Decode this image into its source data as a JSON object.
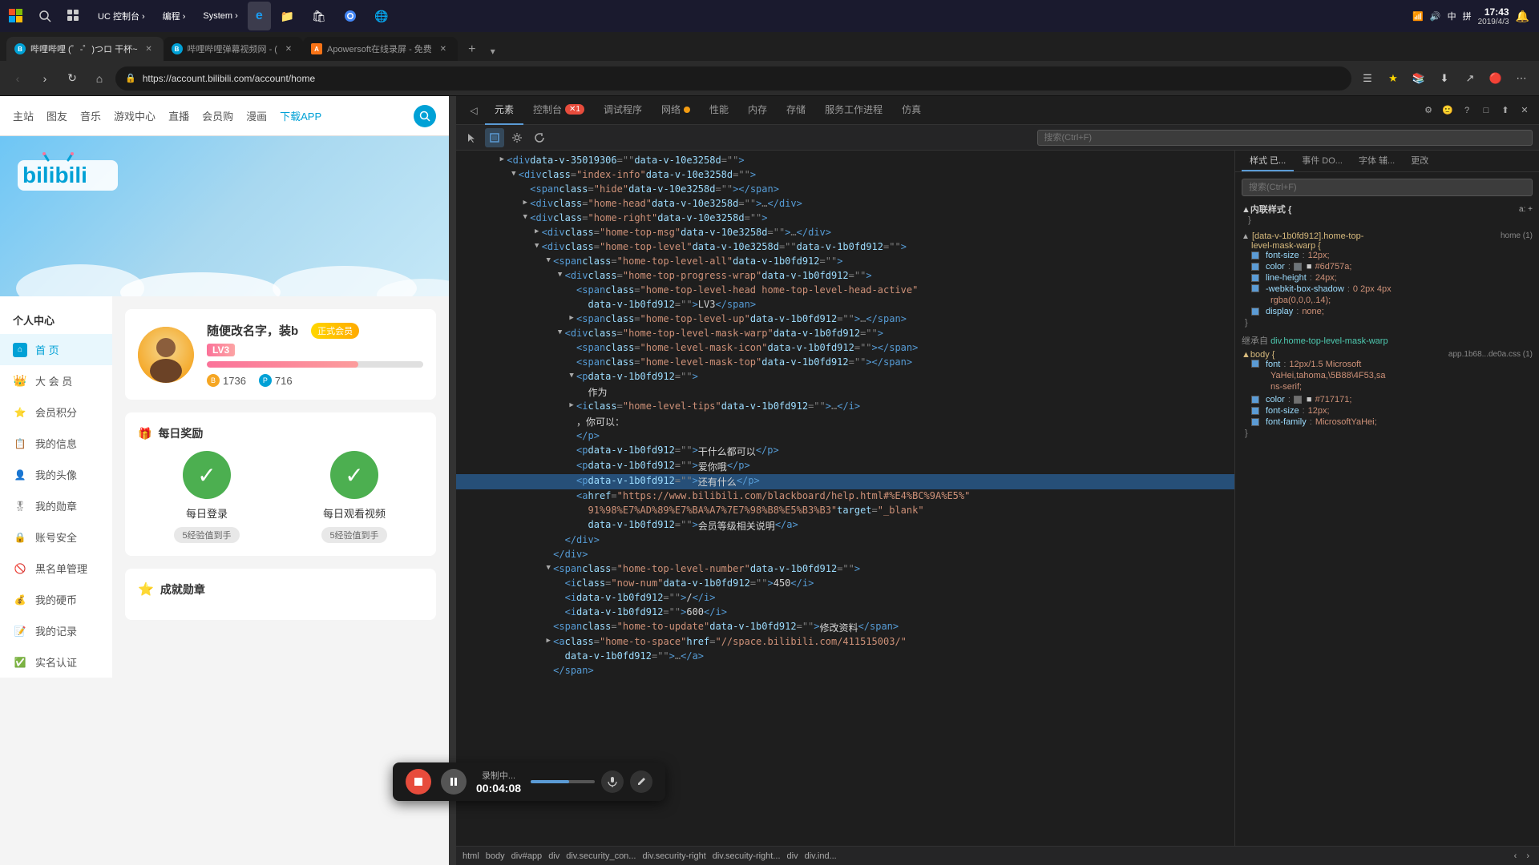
{
  "taskbar": {
    "start_icon": "⊞",
    "search_icon": "⚲",
    "apps": [
      {
        "label": "UC 控制台",
        "active": false,
        "has_arrow": true
      },
      {
        "label": "编程",
        "active": false,
        "has_arrow": true
      },
      {
        "label": "System",
        "active": false,
        "has_arrow": true
      }
    ],
    "ie_label": "e",
    "file_explorer_label": "📁",
    "store_label": "🛍",
    "chrome_label": "●",
    "edge_label": "🌐",
    "time": "17:43",
    "date": "2019/4/3"
  },
  "browser": {
    "tabs": [
      {
        "favicon_color": "#00a1d6",
        "title": "哔哩哔哩 (゜-゜)つロ 干杯~",
        "active": true
      },
      {
        "favicon_color": "#00a1d6",
        "title": "哔哩哔哩弹幕视频网 - (",
        "active": false
      },
      {
        "favicon_color": "#f97316",
        "title": "Apowersoft在线录屏 - 免费",
        "active": false
      }
    ],
    "url": "https://account.bilibili.com/account/home",
    "search_placeholder": "搜索(Ctrl+F)"
  },
  "bilibili": {
    "nav_items": [
      "主站",
      "图友",
      "音乐",
      "游戏中心",
      "直播",
      "会员购",
      "漫画"
    ],
    "download_app": "下载APP",
    "user_section": {
      "center_label": "个人中心",
      "username": "随便改名字，装b",
      "member_badge": "正式会员",
      "level": "LV3",
      "level_fill_percent": 70,
      "coins": "1736",
      "points": "716"
    },
    "sidebar_items": [
      {
        "label": "首 页",
        "icon": "🏠",
        "active": true
      },
      {
        "label": "大 会 员",
        "icon": "👑"
      },
      {
        "label": "会员积分",
        "icon": "⭐"
      },
      {
        "label": "我的信息",
        "icon": "📋"
      },
      {
        "label": "我的头像",
        "icon": "👤"
      },
      {
        "label": "我的勋章",
        "icon": "🎖"
      },
      {
        "label": "账号安全",
        "icon": "🔒"
      },
      {
        "label": "黑名单管理",
        "icon": "🚫"
      },
      {
        "label": "我的硬币",
        "icon": "💰"
      },
      {
        "label": "我的记录",
        "icon": "📝"
      },
      {
        "label": "实名认证",
        "icon": "✅"
      }
    ],
    "daily_rewards": {
      "title": "每日奖励",
      "items": [
        {
          "label": "每日登录",
          "reward": "5经验值到手"
        },
        {
          "label": "每日观看视频",
          "reward": "5经验值到手"
        }
      ]
    },
    "achievement": {
      "title": "成就勋章"
    }
  },
  "devtools": {
    "tabs": [
      "元素",
      "控制台",
      "调试程序",
      "网络",
      "性能",
      "内存",
      "存储",
      "服务工作进程",
      "仿真"
    ],
    "console_badge": "1",
    "network_dot": true,
    "search_placeholder": "搜索(Ctrl+F)",
    "toolbar_icons": [
      "cursor",
      "box",
      "gear",
      "refresh"
    ],
    "code_lines": [
      {
        "indent": 6,
        "toggle": "▶",
        "content": "<div data-v-35019306=\"\" data-v-10e3258d=\"\">"
      },
      {
        "indent": 8,
        "toggle": "▼",
        "content": "<div class=\"index-info\" data-v-10e3258d=\"\">"
      },
      {
        "indent": 10,
        "toggle": null,
        "content": "<span class=\"hide\" data-v-10e3258d=\"\"></span>"
      },
      {
        "indent": 10,
        "toggle": "▶",
        "content": "<div class=\"home-head\" data-v-10e3258d=\"\">…</div>"
      },
      {
        "indent": 10,
        "toggle": "▼",
        "content": "<div class=\"home-right\" data-v-10e3258d=\"\">"
      },
      {
        "indent": 12,
        "toggle": "▶",
        "content": "<div class=\"home-top-msg\" data-v-10e3258d=\"\">…</div>"
      },
      {
        "indent": 12,
        "toggle": "▼",
        "content": "<div class=\"home-top-level\" data-v-10e3258d=\"\" data-v-1b0fd912=\"\">"
      },
      {
        "indent": 14,
        "toggle": "▼",
        "content": "<span class=\"home-top-level-all\" data-v-1b0fd912=\"\">"
      },
      {
        "indent": 16,
        "toggle": "▼",
        "content": "<div class=\"home-top-progress-wrap\" data-v-1b0fd912=\"\">"
      },
      {
        "indent": 18,
        "toggle": null,
        "content": "<span class=\"home-top-level-head home-top-level-head-active\""
      },
      {
        "indent": 20,
        "toggle": null,
        "content": "data-v-1b0fd912=\"\">LV3</span>"
      },
      {
        "indent": 18,
        "toggle": "▶",
        "content": "<span class=\"home-top-level-up\" data-v-1b0fd912=\"\">…</span>"
      },
      {
        "indent": 16,
        "toggle": "▼",
        "content": "<div class=\"home-top-level-mask-warp\" data-v-1b0fd912=\"\">"
      },
      {
        "indent": 18,
        "toggle": null,
        "content": "<span class=\"home-level-mask-icon\" data-v-1b0fd912=\"\"></span>"
      },
      {
        "indent": 18,
        "toggle": null,
        "content": "<span class=\"home-level-mask-top\" data-v-1b0fd912=\"\"></span>"
      },
      {
        "indent": 18,
        "toggle": "▼",
        "content": "<p data-v-1b0fd912=\"\">"
      },
      {
        "indent": 20,
        "toggle": null,
        "content": "作为"
      },
      {
        "indent": 18,
        "toggle": "▶",
        "content": "<i class=\"home-level-tips\" data-v-1b0fd912=\"\">…</i>"
      },
      {
        "indent": 18,
        "toggle": null,
        "content": "，你可以："
      },
      {
        "indent": 18,
        "toggle": null,
        "content": "</p>"
      },
      {
        "indent": 18,
        "toggle": null,
        "content": "<p data-v-1b0fd912=\"\">干什么都可以</p>"
      },
      {
        "indent": 18,
        "toggle": null,
        "content": "<p data-v-1b0fd912=\"\">爱你哦</p>"
      },
      {
        "indent": 18,
        "toggle": null,
        "content": "<p data-v-1b0fd912=\"\">还有什么</p>",
        "selected": true
      },
      {
        "indent": 18,
        "toggle": null,
        "content": "<a href=\"https://www.bilibili.com/blackboard/help.html#%E4%BC%9A%E5%"
      },
      {
        "indent": 20,
        "toggle": null,
        "content": "91%98%E7%AD%89%E7%BA%A7%7E7%98%B8%E5%B3%B3\" target=\"_blank\""
      },
      {
        "indent": 20,
        "toggle": null,
        "content": "data-v-1b0fd912=\"\">会员等级相关说明</a>"
      },
      {
        "indent": 16,
        "toggle": null,
        "content": "</div>"
      },
      {
        "indent": 14,
        "toggle": null,
        "content": "</div>"
      },
      {
        "indent": 14,
        "toggle": "▼",
        "content": "<span class=\"home-top-level-number\" data-v-1b0fd912=\"\">"
      },
      {
        "indent": 16,
        "toggle": null,
        "content": "<i class=\"now-num\" data-v-1b0fd912=\"\">450</i>"
      },
      {
        "indent": 16,
        "toggle": null,
        "content": "<i data-v-1b0fd912=\"\">/</i>"
      },
      {
        "indent": 16,
        "toggle": null,
        "content": "<i data-v-1b0fd912=\"\">600</i>"
      },
      {
        "indent": 14,
        "toggle": null,
        "content": ""
      },
      {
        "indent": 14,
        "toggle": null,
        "content": "<span class=\"home-to-update\" data-v-1b0fd912=\"\">修改资料</span>"
      },
      {
        "indent": 14,
        "toggle": "▶",
        "content": "<a class=\"home-to-space\" href=\"//space.bilibili.com/411515003/\""
      },
      {
        "indent": 16,
        "toggle": null,
        "content": "data-v-1b0fd912=\"\">…</a>"
      },
      {
        "indent": 14,
        "toggle": null,
        "content": "</span>"
      }
    ],
    "breadcrumb": [
      "html",
      "body",
      "div#app",
      "div",
      "div.security_con...",
      "div.security-right",
      "div.secuity-right...",
      "div",
      "div.ind..."
    ],
    "styles_panel": {
      "filter_placeholder": "搜索(Ctrl+F)",
      "sections": [
        {
          "title": "内联样式 {",
          "source": "",
          "properties": []
        },
        {
          "selector": "▲[data-v-1b0fd912].home-top- level-mask-warp {",
          "source": "home (1)",
          "properties": [
            {
              "name": "font-size",
              "value": "12px",
              "checked": true
            },
            {
              "name": "color",
              "value": "#6d757a",
              "color_swatch": "#6d757a",
              "checked": true
            },
            {
              "name": "line-height",
              "value": "24px",
              "checked": true
            },
            {
              "name": "-webkit-box-shadow",
              "value": "0 2px 4px rgba(0,0,0,.14);",
              "checked": true
            },
            {
              "name": "display",
              "value": "none",
              "checked": true
            }
          ]
        }
      ],
      "inherited_title": "继承自 div.home-top-level-mask-warp",
      "inherited_source": "home (1)",
      "body_section": {
        "selector": "▲body {",
        "source": "app.1b68...de0a.css (1)",
        "properties": [
          {
            "name": "font",
            "value": "12px/1.5 Microsoft YaHei,tahoma,\\5B88\\4F53,sa ns-serif;",
            "checked": true
          },
          {
            "name": "color",
            "value": "#717171",
            "color_swatch": "#717171",
            "checked": true
          },
          {
            "name": "font-size",
            "value": "12px",
            "checked": true
          },
          {
            "name": "font-family",
            "value": "MicrosoftYaHei;",
            "checked": true
          }
        ]
      }
    },
    "right_tabs": [
      "样式 已...",
      "事件 DO...",
      "字体 辅...",
      "更改"
    ],
    "right_icons": [
      "◁",
      "🙂",
      "?",
      "□",
      "⬆",
      "✕"
    ]
  },
  "recording": {
    "status": "录制中...",
    "time": "00:04:08"
  }
}
